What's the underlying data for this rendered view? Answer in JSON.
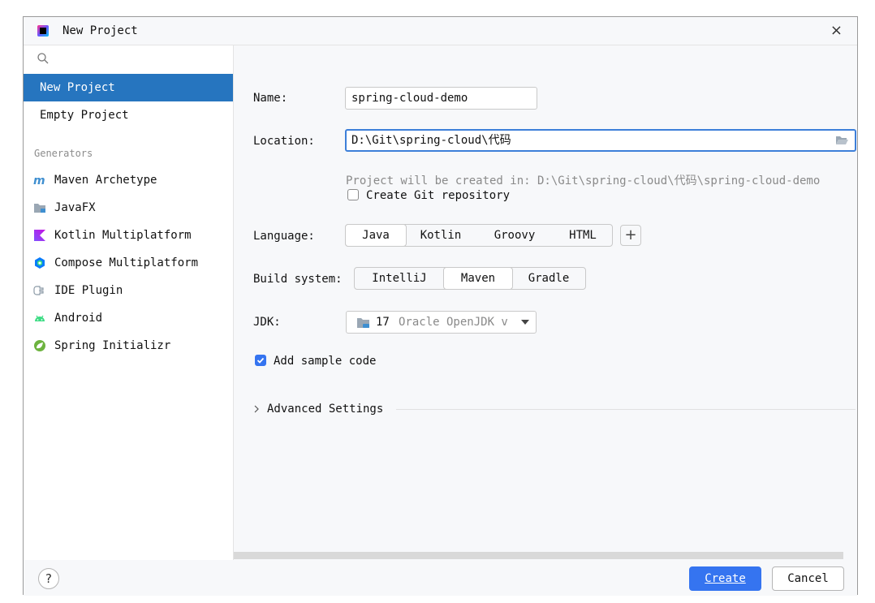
{
  "window": {
    "title": "New Project",
    "close_symbol": "×"
  },
  "sidebar": {
    "search_placeholder": "",
    "items": [
      {
        "label": "New Project",
        "selected": true
      },
      {
        "label": "Empty Project",
        "selected": false
      }
    ],
    "generators_header": "Generators",
    "generators": [
      {
        "label": "Maven Archetype",
        "icon": "maven-icon"
      },
      {
        "label": "JavaFX",
        "icon": "folder-icon"
      },
      {
        "label": "Kotlin Multiplatform",
        "icon": "kotlin-icon"
      },
      {
        "label": "Compose Multiplatform",
        "icon": "compose-icon"
      },
      {
        "label": "IDE Plugin",
        "icon": "plugin-icon"
      },
      {
        "label": "Android",
        "icon": "android-icon"
      },
      {
        "label": "Spring Initializr",
        "icon": "spring-icon"
      }
    ]
  },
  "form": {
    "name_label": "Name:",
    "name_value": "spring-cloud-demo",
    "location_label": "Location:",
    "location_value": "D:\\Git\\spring-cloud\\代码",
    "location_hint": "Project will be created in: D:\\Git\\spring-cloud\\代码\\spring-cloud-demo",
    "git_label": "Create Git repository",
    "git_checked": false,
    "language_label": "Language:",
    "languages": [
      "Java",
      "Kotlin",
      "Groovy",
      "HTML"
    ],
    "language_selected": "Java",
    "add_symbol": "+",
    "build_label": "Build system:",
    "build_systems": [
      "IntelliJ",
      "Maven",
      "Gradle"
    ],
    "build_selected": "Maven",
    "jdk_label": "JDK:",
    "jdk_version": "17",
    "jdk_name": "Oracle OpenJDK v",
    "sample_label": "Add sample code",
    "sample_checked": true,
    "advanced_label": "Advanced Settings"
  },
  "footer": {
    "help_symbol": "?",
    "create_label": "Create",
    "cancel_label": "Cancel"
  },
  "colors": {
    "selected_bg": "#2675bf",
    "accent": "#3574f0",
    "focus_border": "#3d7fd9"
  }
}
